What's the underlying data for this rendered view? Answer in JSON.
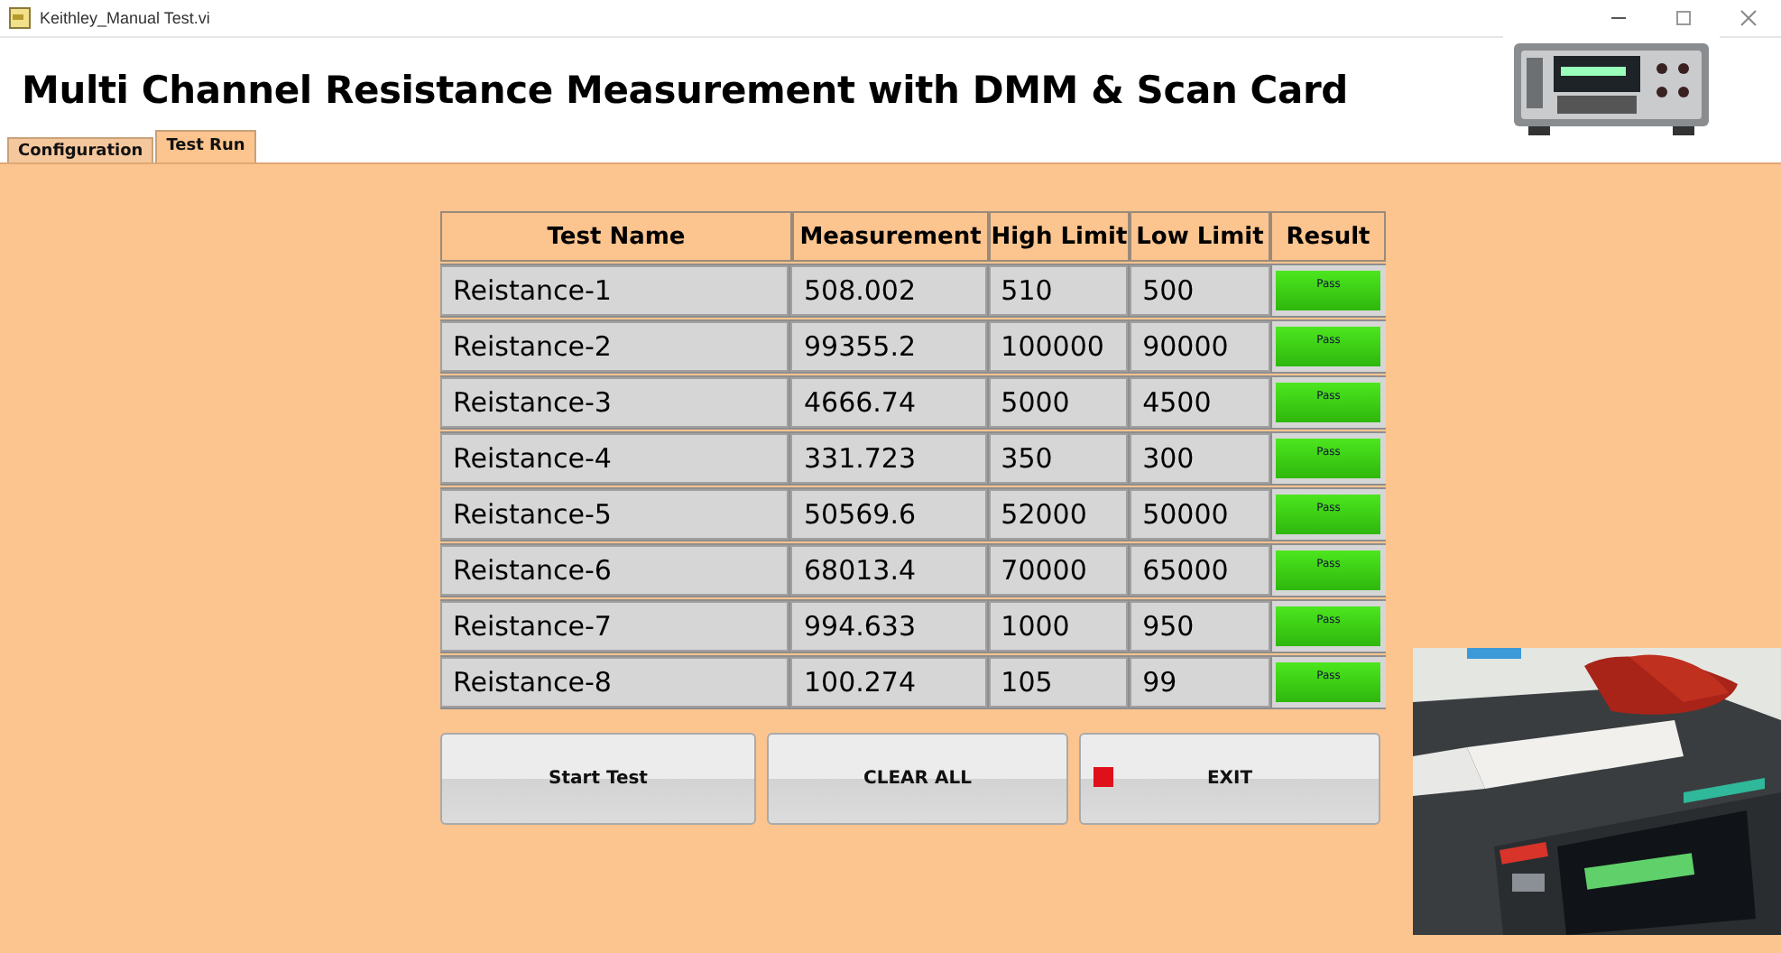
{
  "window": {
    "title": "Keithley_Manual Test.vi"
  },
  "heading": "Multi Channel Resistance Measurement with DMM & Scan Card",
  "tabs": [
    {
      "label": "Configuration",
      "selected": false
    },
    {
      "label": "Test Run",
      "selected": true
    }
  ],
  "table": {
    "columns": [
      "Test Name",
      "Measurement",
      "High Limit",
      "Low Limit",
      "Result"
    ],
    "rows": [
      {
        "test_name": "Reistance-1",
        "measurement": "508.002",
        "high_limit": "510",
        "low_limit": "500",
        "result": "Pass",
        "passed": true
      },
      {
        "test_name": "Reistance-2",
        "measurement": "99355.2",
        "high_limit": "100000",
        "low_limit": "90000",
        "result": "Pass",
        "passed": true
      },
      {
        "test_name": "Reistance-3",
        "measurement": "4666.74",
        "high_limit": "5000",
        "low_limit": "4500",
        "result": "Pass",
        "passed": true
      },
      {
        "test_name": "Reistance-4",
        "measurement": "331.723",
        "high_limit": "350",
        "low_limit": "300",
        "result": "Pass",
        "passed": true
      },
      {
        "test_name": "Reistance-5",
        "measurement": "50569.6",
        "high_limit": "52000",
        "low_limit": "50000",
        "result": "Pass",
        "passed": true
      },
      {
        "test_name": "Reistance-6",
        "measurement": "68013.4",
        "high_limit": "70000",
        "low_limit": "65000",
        "result": "Pass",
        "passed": true
      },
      {
        "test_name": "Reistance-7",
        "measurement": "994.633",
        "high_limit": "1000",
        "low_limit": "950",
        "result": "Pass",
        "passed": true
      },
      {
        "test_name": "Reistance-8",
        "measurement": "100.274",
        "high_limit": "105",
        "low_limit": "99",
        "result": "Pass",
        "passed": true
      }
    ]
  },
  "buttons": [
    {
      "label": "Start Test",
      "kind": "plain"
    },
    {
      "label": "CLEAR ALL",
      "kind": "plain"
    },
    {
      "label": "EXIT",
      "kind": "stop"
    }
  ]
}
